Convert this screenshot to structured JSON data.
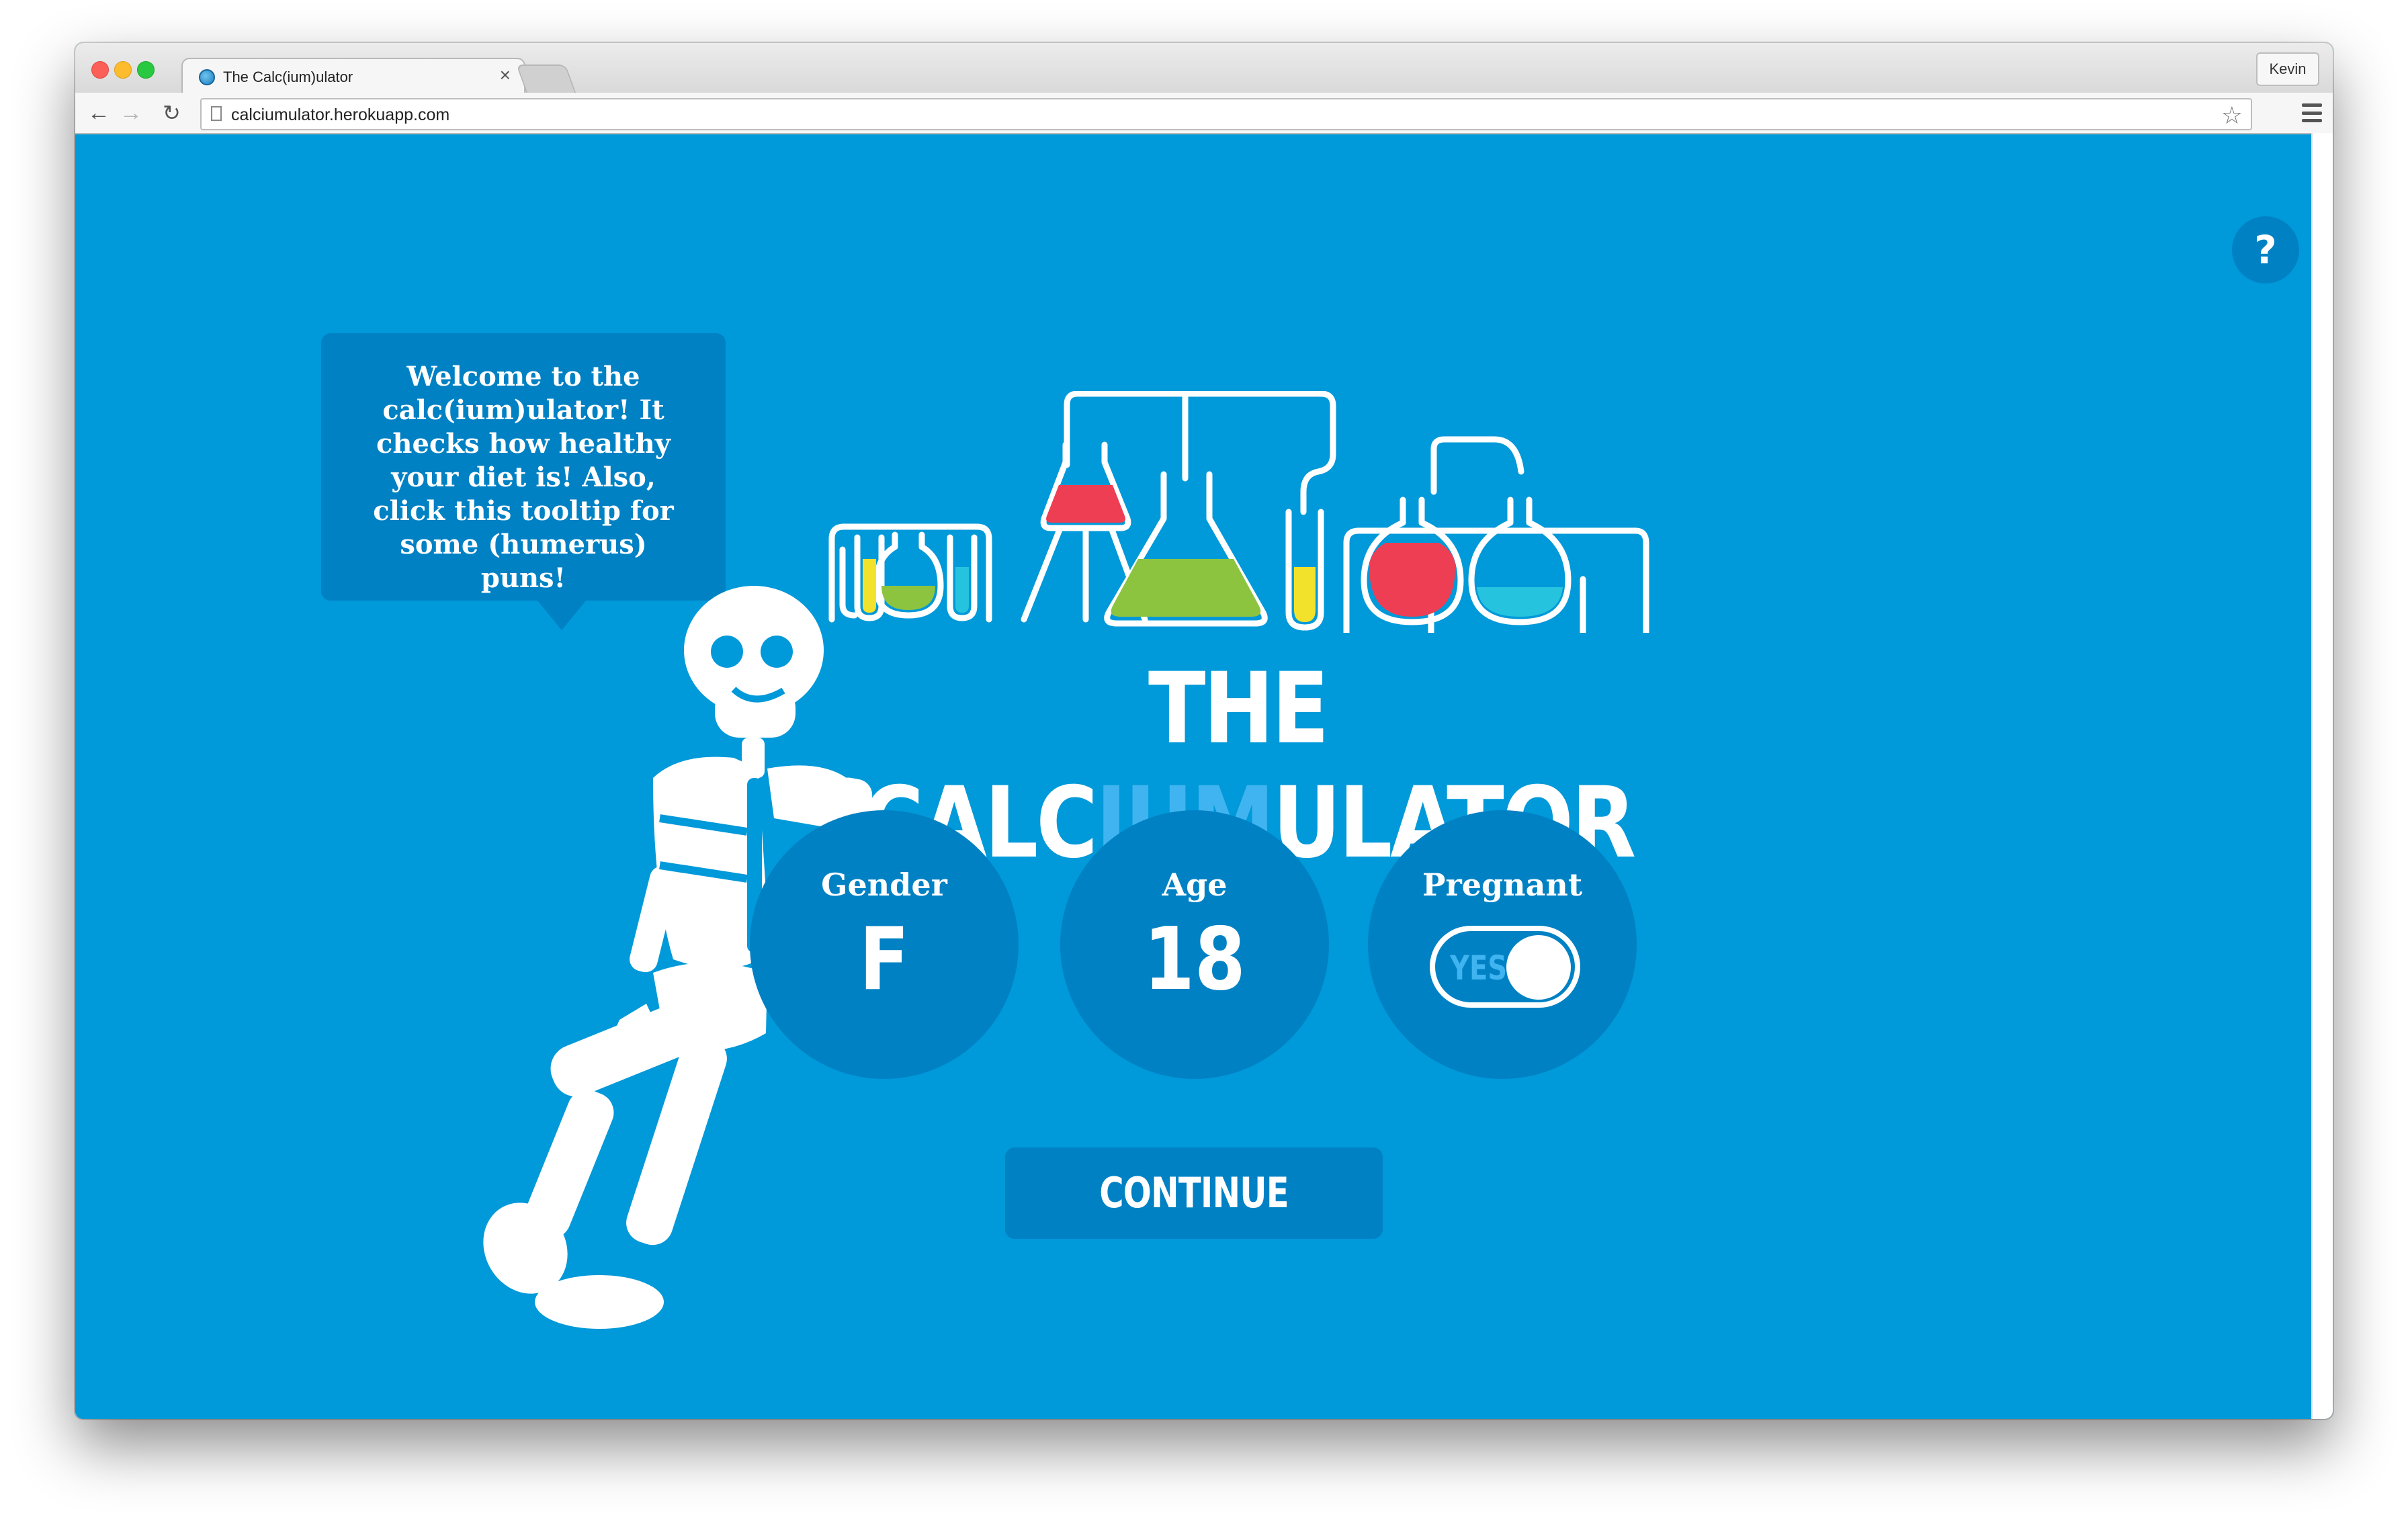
{
  "browser": {
    "tab_title": "The Calc(ium)ulator",
    "tab_close": "×",
    "profile_name": "Kevin",
    "url": "calciumulator.herokuapp.com",
    "nav": {
      "back": "←",
      "forward": "→",
      "reload": "↻",
      "star": "☆"
    }
  },
  "page": {
    "help": "?",
    "tooltip": "Welcome to the calc(ium)ulator! It checks how healthy your diet is! Also, click this tooltip for some (humerus) puns!",
    "logo": {
      "part1": "THE CALC",
      "highlight": "IUM",
      "part2": "ULATOR"
    },
    "fields": {
      "gender": {
        "label": "Gender",
        "value": "F"
      },
      "age": {
        "label": "Age",
        "value": "18"
      },
      "pregnant": {
        "label": "Pregnant",
        "toggle_text": "YES",
        "on": true
      }
    },
    "continue_label": "CONTINUE"
  },
  "colors": {
    "background": "#0099d9",
    "panel": "#0081c4",
    "highlight": "#3fb4f0",
    "flask_red": "#ee3e54",
    "flask_green": "#8cc43f",
    "flask_yellow": "#f2e22c",
    "flask_cyan": "#26c3de"
  },
  "icons": [
    "help-icon",
    "skeleton-illustration",
    "lab-equipment-illustration",
    "favicon-icon",
    "star-icon",
    "menu-icon"
  ]
}
